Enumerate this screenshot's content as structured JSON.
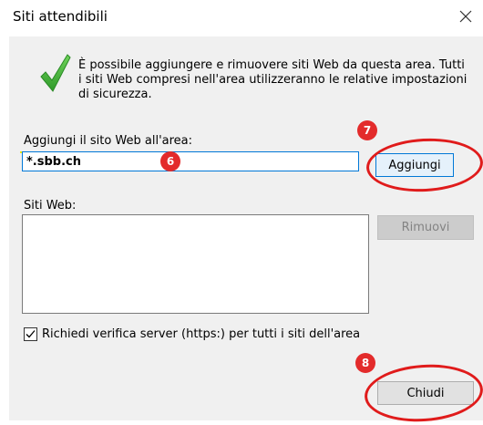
{
  "dialog": {
    "title": "Siti attendibili",
    "close_icon": "close-icon"
  },
  "info": {
    "icon": "checkmark-icon",
    "lines": [
      "È possibile aggiungere e rimuovere siti Web da questa area. Tutti",
      "i siti Web compresi nell'area utilizzeranno le relative impostazioni",
      "di sicurezza."
    ]
  },
  "add_site": {
    "label": "Aggiungi il sito Web all'area:",
    "value": "*.sbb.ch",
    "button_label": "Aggiungi"
  },
  "websites": {
    "label": "Siti Web:",
    "items": [],
    "remove_label": "Rimuovi"
  },
  "https_check": {
    "label": "Richiedi verifica server (https:) per tutti i siti dell'area",
    "checked": true
  },
  "footer": {
    "close_label": "Chiudi"
  },
  "annotations": {
    "badge_6": "6",
    "badge_7": "7",
    "badge_8": "8",
    "badge_color": "#e32b2b",
    "ring_color": "#e01b1b",
    "highlight_color": "#e8e800"
  }
}
